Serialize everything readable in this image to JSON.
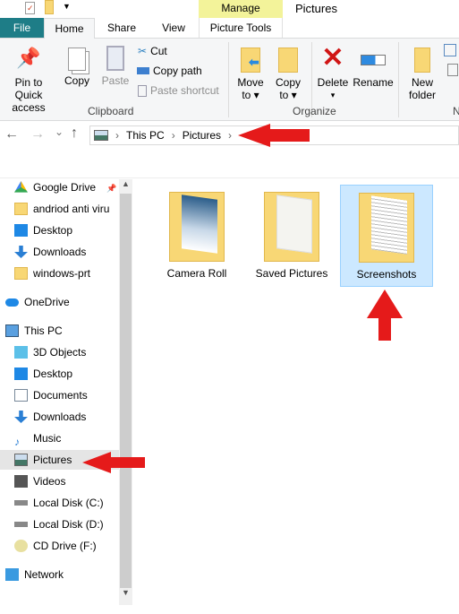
{
  "window": {
    "title": "Pictures",
    "context_tab": "Manage"
  },
  "tabs": [
    {
      "label": "File"
    },
    {
      "label": "Home"
    },
    {
      "label": "Share"
    },
    {
      "label": "View"
    },
    {
      "label": "Picture Tools"
    }
  ],
  "ribbon": {
    "clipboard": {
      "pin_l1": "Pin to Quick",
      "pin_l2": "access",
      "copy": "Copy",
      "paste": "Paste",
      "cut": "Cut",
      "copy_path": "Copy path",
      "paste_shortcut": "Paste shortcut",
      "group": "Clipboard"
    },
    "organize": {
      "move_l1": "Move",
      "move_l2": "to ▾",
      "copy_l1": "Copy",
      "copy_l2": "to ▾",
      "delete": "Delete",
      "delete_arrow": "▾",
      "rename": "Rename",
      "group": "Organize"
    },
    "new": {
      "new_l1": "New",
      "new_l2": "folder",
      "group": "N"
    }
  },
  "address": {
    "back": "←",
    "forward": "→",
    "recent": "⌄",
    "up": "↑",
    "crumbs": [
      "This PC",
      "Pictures"
    ],
    "sep": "›"
  },
  "nav": {
    "items": [
      {
        "label": "Google Drive",
        "icon": "google-drive-icon"
      },
      {
        "label": "andriod anti viru",
        "icon": "folder-icon"
      },
      {
        "label": "Desktop",
        "icon": "desktop-icon"
      },
      {
        "label": "Downloads",
        "icon": "downloads-icon"
      },
      {
        "label": "windows-prt",
        "icon": "folder-icon"
      },
      {
        "label": "OneDrive",
        "icon": "onedrive-icon"
      },
      {
        "label": "This PC",
        "icon": "this-pc-icon"
      },
      {
        "label": "3D Objects",
        "icon": "3d-objects-icon"
      },
      {
        "label": "Desktop",
        "icon": "desktop-icon"
      },
      {
        "label": "Documents",
        "icon": "documents-icon"
      },
      {
        "label": "Downloads",
        "icon": "downloads-icon"
      },
      {
        "label": "Music",
        "icon": "music-icon"
      },
      {
        "label": "Pictures",
        "icon": "pictures-icon",
        "selected": true
      },
      {
        "label": "Videos",
        "icon": "videos-icon"
      },
      {
        "label": "Local Disk (C:)",
        "icon": "local-disk-icon"
      },
      {
        "label": "Local Disk (D:)",
        "icon": "local-disk-icon"
      },
      {
        "label": "CD Drive (F:)",
        "icon": "cd-drive-icon"
      },
      {
        "label": "Network",
        "icon": "network-icon"
      }
    ]
  },
  "folders": [
    {
      "label": "Camera Roll"
    },
    {
      "label": "Saved Pictures"
    },
    {
      "label": "Screenshots",
      "selected": true
    }
  ],
  "colors": {
    "file_tab": "#1e7d87",
    "manage": "#f3f39a",
    "selected": "#cce8ff",
    "arrow": "#e51a1a",
    "folder": "#f8d775"
  }
}
